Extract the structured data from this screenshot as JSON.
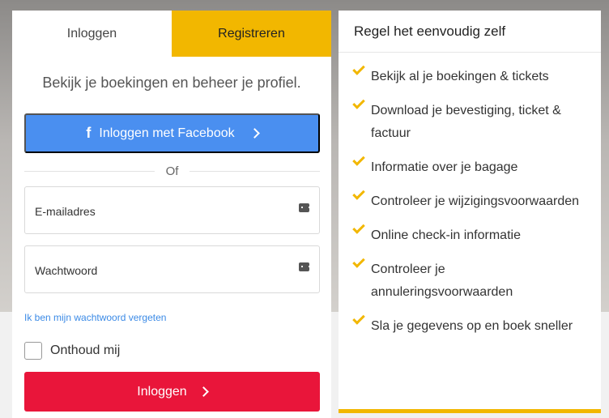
{
  "tabs": {
    "login": "Inloggen",
    "register": "Registreren"
  },
  "intro": "Bekijk je boekingen en beheer je profiel.",
  "facebook_button": "Inloggen met Facebook",
  "divider": "Of",
  "email": {
    "placeholder": "E-mailadres"
  },
  "password": {
    "placeholder": "Wachtwoord"
  },
  "forgot_link": "Ik ben mijn wachtwoord vergeten",
  "remember_label": "Onthoud mij",
  "login_button": "Inloggen",
  "info": {
    "title": "Regel het eenvoudig zelf",
    "items": [
      "Bekijk al je boekingen & tickets",
      "Download je bevestiging, ticket & factuur",
      "Informatie over je bagage",
      "Controleer je wijzigingsvoorwaarden",
      "Online check-in informatie",
      "Controleer je annuleringsvoorwaarden",
      "Sla je gegevens op en boek sneller"
    ]
  },
  "colors": {
    "accent_yellow": "#f2b700",
    "facebook_blue": "#4a8ff0",
    "login_red": "#e9153a",
    "link_blue": "#3b8ae6"
  },
  "icons": [
    "facebook-icon",
    "chevron-right-icon",
    "keyboard-icon",
    "check-icon"
  ]
}
